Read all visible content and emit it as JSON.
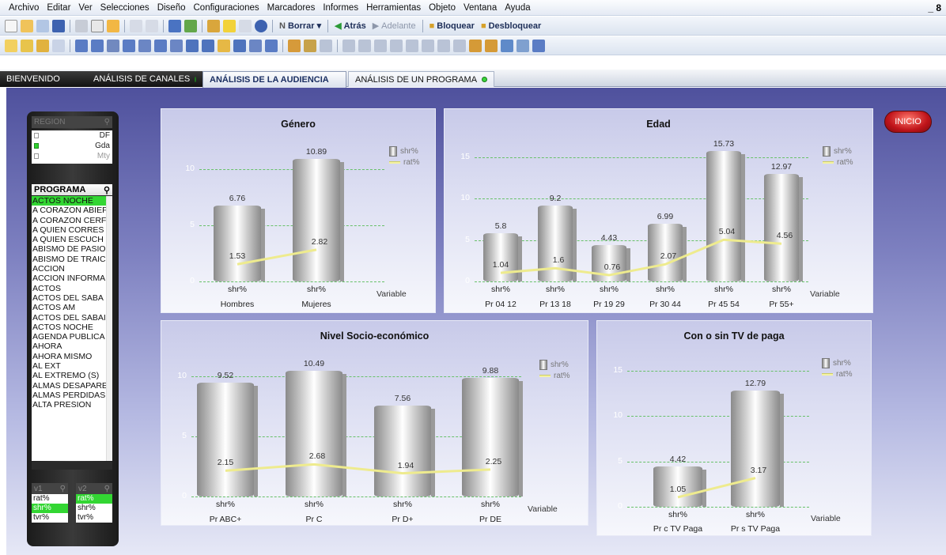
{
  "menu": [
    "Archivo",
    "Editar",
    "Ver",
    "Selecciones",
    "Diseño",
    "Configuraciones",
    "Marcadores",
    "Informes",
    "Herramientas",
    "Objeto",
    "Ventana",
    "Ayuda"
  ],
  "window_controls": "_ 8",
  "toolbar1": {
    "borrar": "Borrar",
    "atras": "Atrás",
    "adelante": "Adelante",
    "bloquear": "Bloquear",
    "desbloquear": "Desbloquear"
  },
  "tabs": [
    {
      "label": "BIENVENIDO",
      "dot": false
    },
    {
      "label": "ANÁLISIS DE CANALES",
      "dot": true
    },
    {
      "label": "ANÁLISIS DE LA AUDIENCIA",
      "dot": false
    },
    {
      "label": "ANÁLISIS DE UN PROGRAMA",
      "dot": true
    }
  ],
  "sidebar": {
    "region_header": "REGION",
    "regions": [
      {
        "label": "DF",
        "selected": false
      },
      {
        "label": "Gda",
        "selected": true
      },
      {
        "label": "Mty",
        "selected": false
      }
    ],
    "programa_header": "PROGRAMA",
    "programs": [
      "ACTOS  NOCHE",
      "A CORAZON ABIEF",
      "A CORAZON CERF",
      "A QUIEN CORRES",
      "A QUIEN ESCUCH",
      "ABISMO DE PASIOI",
      "ABISMO DE TRAICI",
      "ACCION",
      "ACCION INFORMA",
      "ACTOS",
      "ACTOS  DEL SABA",
      "ACTOS AM",
      "ACTOS DEL SABAI",
      "ACTOS NOCHE",
      "AGENDA PUBLICA",
      "AHORA",
      "AHORA MISMO",
      "AL EXT",
      "AL EXTREMO (S)",
      "ALMAS DESAPARE",
      "ALMAS PERDIDAS",
      "ALTA PRESION"
    ],
    "v1_header": "v1",
    "v2_header": "v2",
    "v1_items": [
      {
        "label": "rat%",
        "selected": false
      },
      {
        "label": "shr%",
        "selected": true
      },
      {
        "label": "tvr%",
        "selected": false
      }
    ],
    "v2_items": [
      {
        "label": "rat%",
        "selected": true
      },
      {
        "label": "shr%",
        "selected": false
      },
      {
        "label": "tvr%",
        "selected": false
      }
    ]
  },
  "inicio_button": "INICIO",
  "colors": {
    "bar": "#d0d0d0",
    "line": "#f4f2a2",
    "grid": "#68c16a",
    "selected": "#33d633"
  },
  "chart_data": [
    {
      "type": "bar",
      "title": "Género",
      "xlabel": "Variable",
      "categories": [
        "Hombres",
        "Mujeres"
      ],
      "bar_labels": [
        "shr%",
        "shr%"
      ],
      "series": [
        {
          "name": "shr%",
          "values": [
            6.76,
            10.89
          ]
        },
        {
          "name": "rat%",
          "values": [
            1.53,
            2.82
          ],
          "type": "line"
        }
      ],
      "yticks": [
        0,
        5,
        10
      ],
      "ylim": [
        0,
        12.5
      ],
      "legend": "top-right"
    },
    {
      "type": "bar",
      "title": "Edad",
      "xlabel": "Variable",
      "categories": [
        "Pr 04 12",
        "Pr 13 18",
        "Pr 19 29",
        "Pr 30 44",
        "Pr 45 54",
        "Pr 55+"
      ],
      "bar_labels": [
        "shr%",
        "shr%",
        "shr%",
        "shr%",
        "shr%",
        "shr%"
      ],
      "series": [
        {
          "name": "shr%",
          "values": [
            5.8,
            9.2,
            4.43,
            6.99,
            15.73,
            12.97
          ]
        },
        {
          "name": "rat%",
          "values": [
            1.04,
            1.6,
            0.76,
            2.07,
            5.04,
            4.56
          ],
          "type": "line"
        }
      ],
      "yticks": [
        0,
        5,
        10,
        15
      ],
      "ylim": [
        0,
        17
      ],
      "legend": "top-right"
    },
    {
      "type": "bar",
      "title": "Nivel Socio-económico",
      "xlabel": "Variable",
      "categories": [
        "Pr ABC+",
        "Pr C",
        "Pr D+",
        "Pr DE"
      ],
      "bar_labels": [
        "shr%",
        "shr%",
        "shr%",
        "shr%"
      ],
      "series": [
        {
          "name": "shr%",
          "values": [
            9.52,
            10.49,
            7.56,
            9.88
          ]
        },
        {
          "name": "rat%",
          "values": [
            2.15,
            2.68,
            1.94,
            2.25
          ],
          "type": "line"
        }
      ],
      "yticks": [
        0,
        5,
        10
      ],
      "ylim": [
        0,
        12
      ],
      "legend": "top-right"
    },
    {
      "type": "bar",
      "title": "Con o sin TV de paga",
      "xlabel": "Variable",
      "categories": [
        "Pr c TV Paga",
        "Pr s TV Paga"
      ],
      "bar_labels": [
        "shr%",
        "shr%"
      ],
      "series": [
        {
          "name": "shr%",
          "values": [
            4.42,
            12.79
          ]
        },
        {
          "name": "rat%",
          "values": [
            1.05,
            3.17
          ],
          "type": "line"
        }
      ],
      "yticks": [
        0,
        5,
        10,
        15
      ],
      "ylim": [
        0,
        17
      ],
      "legend": "top-right"
    }
  ]
}
